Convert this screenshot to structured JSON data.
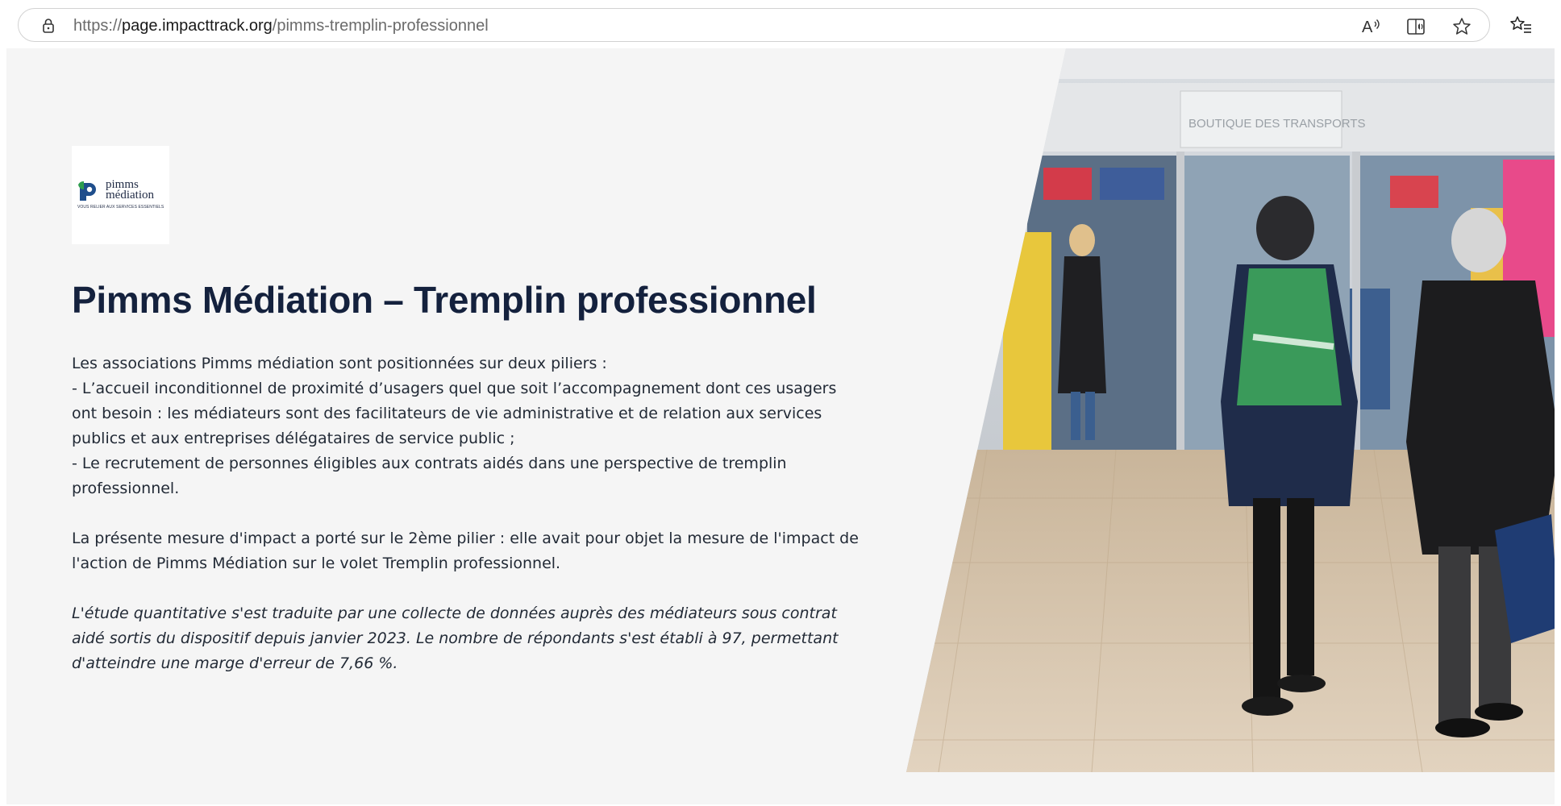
{
  "browser": {
    "url_scheme": "https://",
    "url_host": "page.impacttrack.org",
    "url_path": "/pimms-tremplin-professionnel",
    "icons": [
      "lock-icon",
      "read-aloud-icon",
      "immersive-reader-icon",
      "favorite-star-icon",
      "favorites-bar-icon"
    ]
  },
  "logo": {
    "line1": "pimms",
    "line2": "médiation",
    "tagline": "VOUS RELIER AUX SERVICES ESSENTIELS"
  },
  "main": {
    "title": "Pimms Médiation – Tremplin professionnel",
    "intro": "Les associations Pimms médiation sont positionnées sur deux piliers :",
    "pillar1": "-  L’accueil inconditionnel de proximité d’usagers quel que soit l’accompagnement dont ces usagers ont besoin : les médiateurs sont des facilitateurs de vie administrative et de relation aux services publics et aux entreprises délégataires de service public ;",
    "pillar2": "-  Le recrutement de personnes éligibles aux contrats aidés dans une perspective de tremplin professionnel.",
    "measure": "La présente mesure d'impact a porté sur le 2ème pilier : elle avait pour objet la mesure de l'impact de l'action de Pimms Médiation sur le volet Tremplin professionnel.",
    "study": "L'étude quantitative s'est traduite par une collecte de données auprès des médiateurs sous contrat aidé sortis du dispositif depuis janvier 2023. Le nombre de répondants s'est établi à 97, permettant d'atteindre une marge d'erreur de 7,66 %."
  },
  "photo": {
    "sign_boutique": "BOUTIQUE DES TRANSPORTS"
  },
  "colors": {
    "title": "#14213d",
    "page_bg": "#f5f5f5",
    "logo_green": "#2e9e4f",
    "logo_blue": "#1f4e8c"
  }
}
